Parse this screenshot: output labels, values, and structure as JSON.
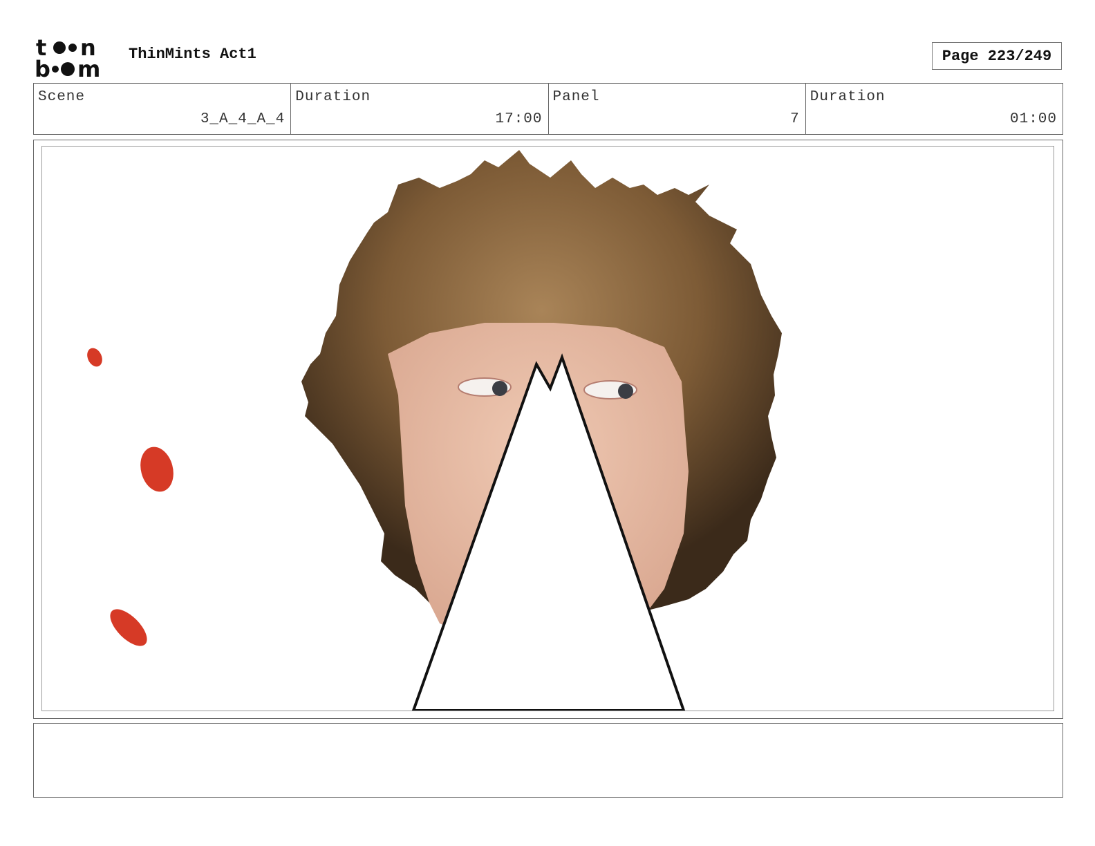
{
  "header": {
    "logo": {
      "icon": "toon-boom-logo",
      "line1": "toon",
      "line2": "boom"
    },
    "project_title": "ThinMints Act1",
    "page_label": "Page 223/249"
  },
  "info": [
    {
      "label": "Scene",
      "value": "3_A_4_A_4"
    },
    {
      "label": "Duration",
      "value": "17:00"
    },
    {
      "label": "Panel",
      "value": "7"
    },
    {
      "label": "Duration",
      "value": "01:00"
    }
  ],
  "panel": {
    "art_icon": "character-face-cutout-icon",
    "accent_color": "#d63a26"
  },
  "notes": {
    "text": ""
  }
}
